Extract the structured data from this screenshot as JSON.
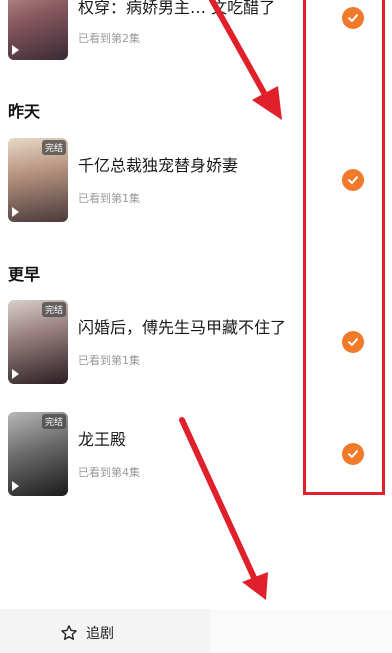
{
  "items": [
    {
      "title": "权穿：病娇男主… 文吃醋了",
      "progress": "已看到第2集",
      "badge": ""
    },
    {
      "title": "千亿总裁独宠替身娇妻",
      "progress": "已看到第1集",
      "badge": "完结"
    },
    {
      "title": "闪婚后，傅先生马甲藏不住了",
      "progress": "已看到第1集",
      "badge": "完结"
    },
    {
      "title": "龙王殿",
      "progress": "已看到第4集",
      "badge": "完结"
    }
  ],
  "sections": {
    "yesterday": "昨天",
    "earlier": "更早"
  },
  "bottom": {
    "follow_label": "追剧"
  },
  "colors": {
    "check": "#f07a2a",
    "annotation": "#e0202a"
  }
}
